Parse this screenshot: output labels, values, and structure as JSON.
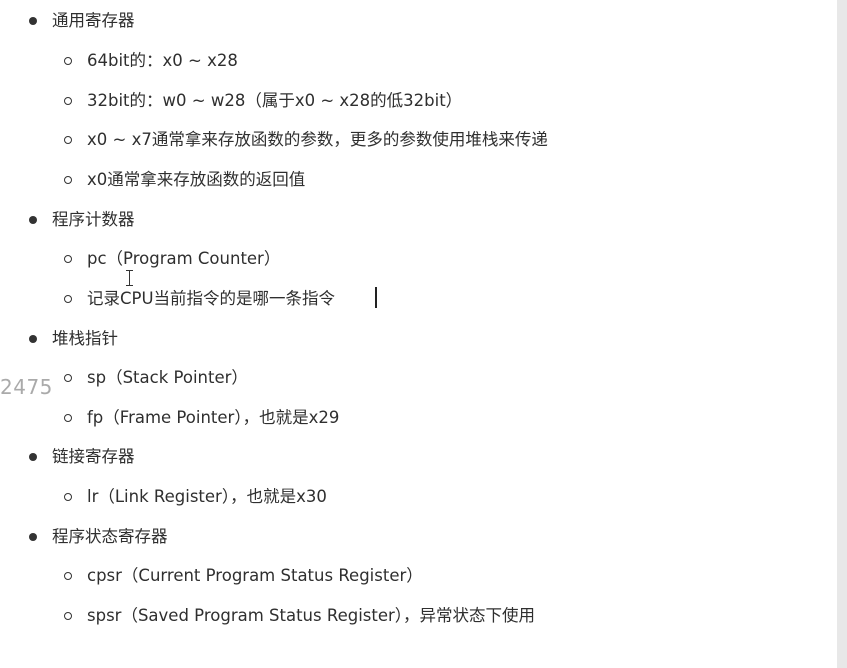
{
  "side_number": "2475",
  "outline": [
    {
      "label": "通用寄存器",
      "children": [
        "64bit的：x0 ~ x28",
        "32bit的：w0 ~ w28（属于x0 ~ x28的低32bit）",
        "x0 ~ x7通常拿来存放函数的参数，更多的参数使用堆栈来传递",
        "x0通常拿来存放函数的返回值"
      ]
    },
    {
      "label": "程序计数器",
      "children": [
        "pc（Program Counter）",
        "记录CPU当前指令的是哪一条指令"
      ]
    },
    {
      "label": "堆栈指针",
      "children": [
        "sp（Stack Pointer）",
        "fp（Frame Pointer），也就是x29"
      ]
    },
    {
      "label": "链接寄存器",
      "children": [
        "lr（Link Register），也就是x30"
      ]
    },
    {
      "label": "程序状态寄存器",
      "children": [
        "cpsr（Current Program Status Register）",
        "spsr（Saved Program Status Register），异常状态下使用"
      ]
    }
  ]
}
